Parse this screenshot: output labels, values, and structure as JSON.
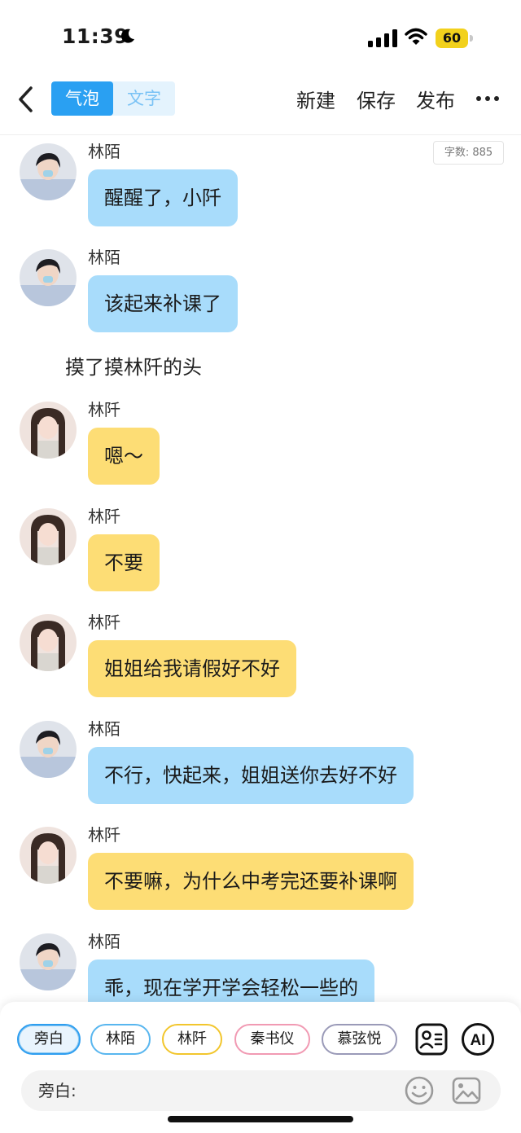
{
  "status_bar": {
    "time": "11:39",
    "battery": "60"
  },
  "nav": {
    "tabs": [
      {
        "label": "气泡",
        "active": true
      },
      {
        "label": "文字",
        "active": false
      }
    ],
    "actions": {
      "new": "新建",
      "save": "保存",
      "publish": "发布"
    }
  },
  "word_count": "字数: 885",
  "messages": [
    {
      "speaker": "林陌",
      "text": "醒醒了，小阡",
      "color": "blue"
    },
    {
      "speaker": "林陌",
      "text": "该起来补课了",
      "color": "blue"
    },
    {
      "narration": "摸了摸林阡的头"
    },
    {
      "speaker": "林阡",
      "text": "嗯～",
      "color": "yellow"
    },
    {
      "speaker": "林阡",
      "text": "不要",
      "color": "yellow"
    },
    {
      "speaker": "林阡",
      "text": "姐姐给我请假好不好",
      "color": "yellow"
    },
    {
      "speaker": "林陌",
      "text": "不行，快起来，姐姐送你去好不好",
      "color": "blue"
    },
    {
      "speaker": "林阡",
      "text": "不要嘛，为什么中考完还要补课啊",
      "color": "yellow"
    },
    {
      "speaker": "林陌",
      "text": "乖，现在学开学会轻松一些的",
      "color": "blue"
    }
  ],
  "roles": [
    {
      "label": "旁白",
      "border": "#2e9ef0",
      "selected": true
    },
    {
      "label": "林陌",
      "border": "#58b6ef",
      "selected": false
    },
    {
      "label": "林阡",
      "border": "#f2c62d",
      "selected": false
    },
    {
      "label": "秦书仪",
      "border": "#f19ab3",
      "selected": false
    },
    {
      "label": "慕弦悦",
      "border": "#9a9ab8",
      "selected": false
    }
  ],
  "tools": {
    "ai": "AI"
  },
  "input": {
    "label": "旁白:"
  }
}
